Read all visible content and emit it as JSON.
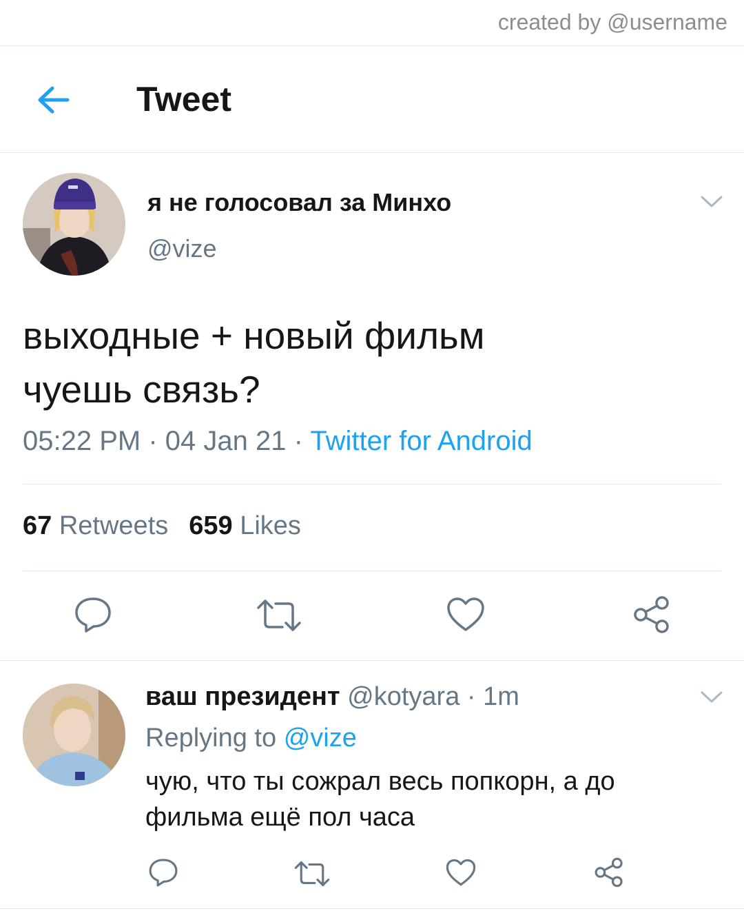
{
  "watermark": "created by @username",
  "header": {
    "title": "Tweet",
    "back_icon": "arrow-left-icon"
  },
  "tweet": {
    "author_name": "я не голосовал за Минхо",
    "author_handle": "@vize",
    "text": "выходные + новый фильм\nчуешь связь?",
    "time": "05:22 PM",
    "date": "04 Jan 21",
    "dot": "·",
    "source": "Twitter for Android",
    "retweets_count": "67",
    "retweets_label": "Retweets",
    "likes_count": "659",
    "likes_label": "Likes"
  },
  "reply": {
    "author_name": "ваш президент",
    "author_handle": "@kotyara",
    "dot": "·",
    "age": "1m",
    "replying_prefix": "Replying to",
    "replying_to": "@vize",
    "text": "чую, что ты сожрал весь попкорн, а до\nфильма ещё пол часа"
  },
  "colors": {
    "accent": "#1da1f2",
    "secondary_text": "#657786",
    "divider": "#e1e8ed",
    "icon_gray": "#657786"
  }
}
